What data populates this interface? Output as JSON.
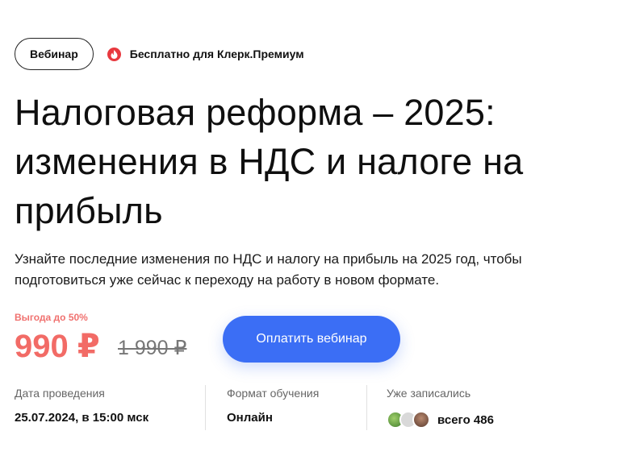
{
  "badge": {
    "label": "Вебинар"
  },
  "premium": {
    "label": "Бесплатно для Клерк.Премиум",
    "icon": "klerk-premium-icon",
    "color": "#e8393f"
  },
  "title": {
    "line1": "Налоговая реформа – 2025:",
    "line2": "изменения в НДС и налоге на",
    "line3": "прибыль"
  },
  "lead": {
    "line1": "Узнайте последние изменения по НДС и налогу на прибыль на 2025 год, чтобы",
    "line2": "подготовиться уже сейчас к переходу на работу в новом формате."
  },
  "pricing": {
    "discount": "Выгода до 50%",
    "price": "990 ₽",
    "old_price": "1 990 ₽",
    "accent_color": "#f26b66"
  },
  "pay_button": {
    "label": "Оплатить вебинар",
    "color": "#3b6ef5"
  },
  "info": {
    "date": {
      "label": "Дата проведения",
      "value": "25.07.2024, в 15:00 мск"
    },
    "format": {
      "label": "Формат обучения",
      "value": "Онлайн"
    },
    "registered": {
      "label": "Уже записались",
      "value": "всего 486"
    }
  }
}
